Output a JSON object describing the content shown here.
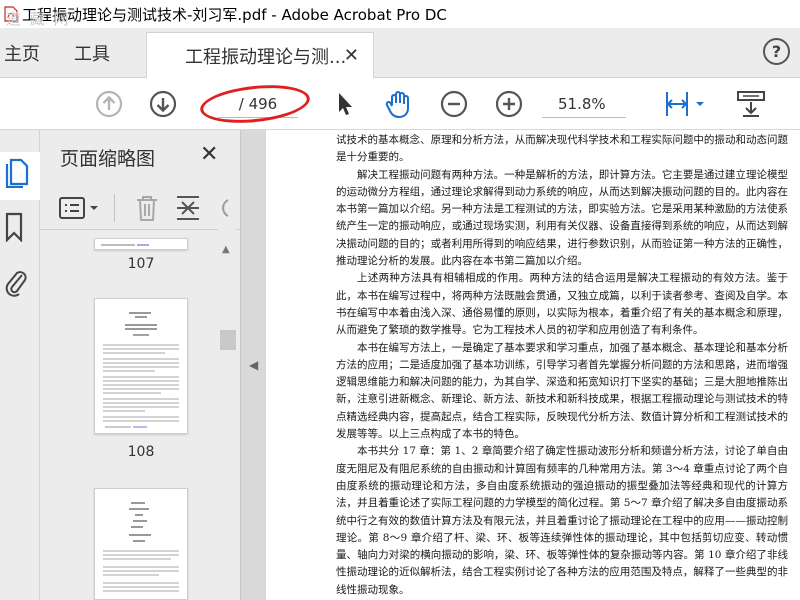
{
  "window": {
    "title": "工程振动理论与测试技术-刘习军.pdf - Adobe Acrobat Pro DC",
    "watermark": "道 藏 网"
  },
  "tabs": {
    "home": "主页",
    "tools": "工具",
    "document": "工程振动理论与测...",
    "close_symbol": "✕",
    "help_symbol": "?"
  },
  "toolbar": {
    "page_indicator": "/ 496",
    "zoom": "51.8%"
  },
  "thumbnail_panel": {
    "title": "页面缩略图",
    "close_symbol": "✕",
    "pages": [
      {
        "label": "107"
      },
      {
        "label": "108"
      }
    ]
  },
  "document": {
    "paragraphs": [
      "试技术的基本概念、原理和分析方法，从而解决现代科学技术和工程实际问题中的振动和动态问题是十分重要的。",
      "解决工程振动问题有两种方法。一种是解析的方法，即计算方法。它主要是通过建立理论模型的运动微分方程组，通过理论求解得到动力系统的响应，从而达到解决振动问题的目的。此内容在本书第一篇加以介绍。另一种方法是工程测试的方法，即实验方法。它是采用某种激励的方法使系统产生一定的振动响应，或通过现场实测，利用有关仪器、设备直接得到系统的响应，从而达到解决振动问题的目的；或者利用所得到的响应结果，进行参数识别，从而验证第一种方法的正确性，推动理论分析的发展。此内容在本书第二篇加以介绍。",
      "上述两种方法具有相辅相成的作用。两种方法的结合运用是解决工程振动的有效方法。鉴于此，本书在编写过程中，将两种方法既融会贯通，又独立成篇，以利于读者参考、查阅及自学。本书在编写中本着由浅入深、通俗易懂的原则，以实际为根本，着重介绍了有关的基本概念和原理，从而避免了繁琐的数学推导。它为工程技术人员的初学和应用创造了有利条件。",
      "本书在编写方法上，一是确定了基本要求和学习重点，加强了基本概念、基本理论和基本分析方法的应用；二是适度加强了基本功训练，引导学习者首先掌握分析问题的方法和思路，进而增强逻辑思维能力和解决问题的能力，为其自学、深造和拓宽知识打下坚实的基础；三是大胆地推陈出新，注意引进新概念、新理论、新方法、新技术和新科技成果，根据工程振动理论与测试技术的特点精选经典内容，提高起点，结合工程实际，反映现代分析方法、数值计算分析和工程测试技术的发展等等。以上三点构成了本书的特色。",
      "本书共分 17 章：第 1、2 章简要介绍了确定性振动波形分析和频谱分析方法，讨论了单自由度无阻尼及有阻尼系统的自由振动和计算固有频率的几种常用方法。第 3～4 章重点讨论了两个自由度系统的振动理论和方法，多自由度系统振动的强迫振动的振型叠加法等经典和现代的计算方法，并且着重论述了实际工程问题的力学模型的简化过程。第 5～7 章介绍了解决多自由度振动系统中行之有效的数值计算方法及有限元法，并且着重讨论了振动理论在工程中的应用——振动控制理论。第 8～9 章介绍了杆、梁、环、板等连续弹性体的振动理论，其中包括剪切应变、转动惯量、轴向力对梁的横向振动的影响，梁、环、板等弹性体的复杂振动等内容。第 10 章介绍了非线性振动理论的近似解析法，结合工程实例讨论了各种方法的应用范围及特点，解释了一些典型的非线性振动现象。"
    ]
  },
  "colors": {
    "accent_blue": "#1c6fd0",
    "annotation_red": "#e02020",
    "chrome_gray": "#ececec"
  }
}
